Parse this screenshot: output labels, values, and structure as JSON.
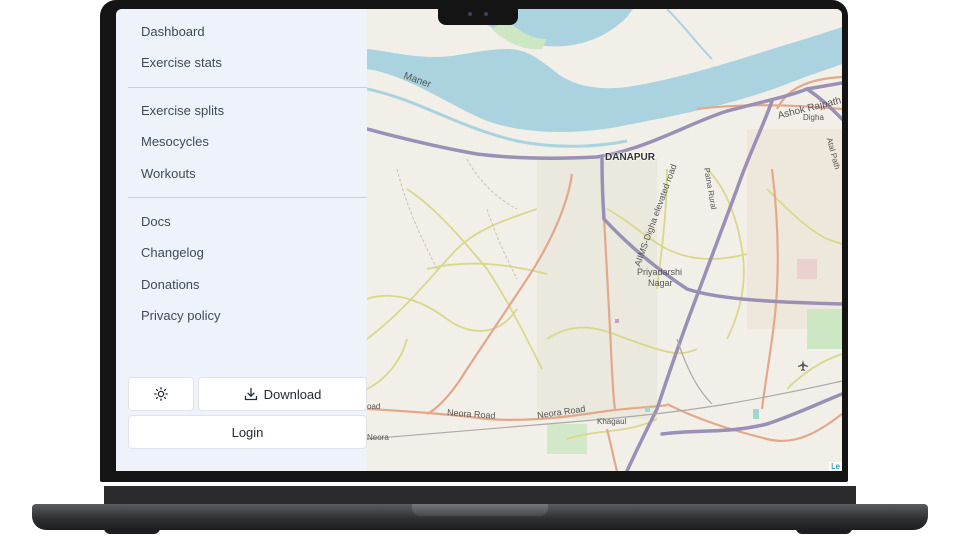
{
  "sidebar": {
    "group1": [
      {
        "label": "Dashboard"
      },
      {
        "label": "Exercise stats"
      }
    ],
    "group2": [
      {
        "label": "Exercise splits"
      },
      {
        "label": "Mesocycles"
      },
      {
        "label": "Workouts"
      }
    ],
    "group3": [
      {
        "label": "Docs"
      },
      {
        "label": "Changelog"
      },
      {
        "label": "Donations"
      },
      {
        "label": "Privacy policy"
      }
    ],
    "theme_toggle_icon": "sun-icon",
    "download_label": "Download",
    "download_icon": "download-icon",
    "login_label": "Login"
  },
  "map": {
    "labels": {
      "danapur": "DANAPUR",
      "maner": "Maner",
      "ashok_rajpath": "Ashok Rajpath",
      "digha": "Digha",
      "patna_rural": "Patna Rural",
      "priyadarshi": "Priyadarshi",
      "nagar": "Nagar",
      "aiims_road": "AIIMS-Digha elevated road",
      "neora_road_1": "Neora Road",
      "neora_road_2": "Neora Road",
      "khagaul": "Khagaul",
      "neora": "Neora",
      "road_left": "oad",
      "atal_path": "Atal Path"
    },
    "attribution": "Le",
    "colors": {
      "land": "#f2efe9",
      "river": "#aad3df",
      "primary_road": "#9a8fb5",
      "secondary_road": "#e3a88a",
      "tertiary_road": "#d8d88a"
    }
  },
  "colors": {
    "sidebar_bg": "#eef3fb",
    "bezel": "#141414"
  }
}
